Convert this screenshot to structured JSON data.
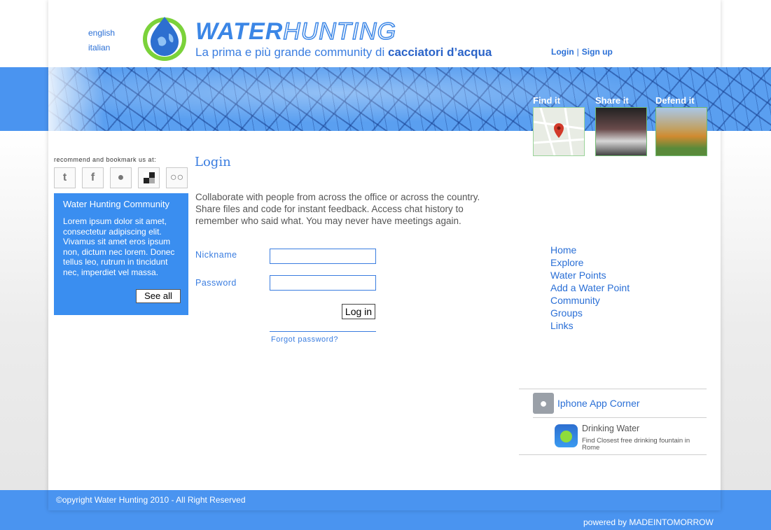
{
  "languages": [
    "english",
    "italian"
  ],
  "logo": {
    "word_bold": "WATER",
    "word_thin": "HUNTING"
  },
  "tagline": {
    "prefix": "La prima e più grande community di ",
    "bold": "cacciatori d’acqua"
  },
  "auth": {
    "login": "Login",
    "separator": "|",
    "signup": "Sign up"
  },
  "features": [
    {
      "label": "Find it"
    },
    {
      "label": "Share it"
    },
    {
      "label": "Defend it"
    }
  ],
  "recommend_label": "recommend and bookmark us at:",
  "social_icons": [
    "twitter-icon",
    "facebook-icon",
    "myspace-icon",
    "delicious-icon",
    "chat-icon"
  ],
  "community": {
    "title": "Water Hunting Community",
    "text": "Lorem ipsum dolor sit amet, consectetur adipiscing elit. Vivamus sit amet eros ipsum non, dictum nec lorem. Donec tellus leo, rutrum in tincidunt nec, imperdiet vel massa.",
    "button": "See all"
  },
  "login": {
    "title": "Login",
    "intro": "Collaborate with people from across the office or across the country. Share files and code for instant feedback. Access chat history to remember who said what. You may never have meetings again.",
    "nickname_label": "Nickname",
    "nickname_value": "",
    "password_label": "Password",
    "password_value": "",
    "button": "Log in",
    "forgot": "Forgot password?"
  },
  "nav": [
    "Home",
    "Explore",
    "Water Points",
    "Add a Water Point",
    "Community",
    "Groups",
    "Links"
  ],
  "iphone": {
    "title": "Iphone App Corner",
    "app_name": "Drinking Water",
    "app_desc": "Find Closest free drinking fountain in Rome"
  },
  "footer": {
    "copyright": "©opyright Water Hunting 2010 - All Right Reserved",
    "powered": "powered by MADEINTOMORROW"
  },
  "colors": {
    "brand_blue": "#4a94f0",
    "link_blue": "#2a6fd6"
  }
}
